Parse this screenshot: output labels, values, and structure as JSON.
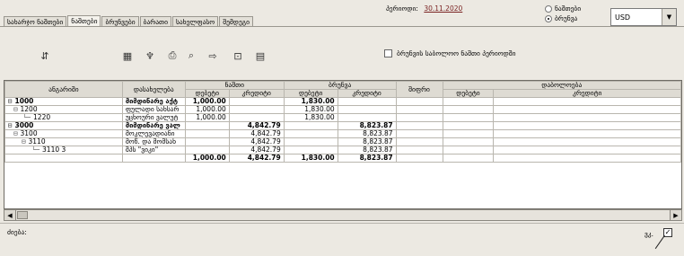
{
  "tabs": [
    {
      "label": "სახარჯო ნაშთები",
      "active": false
    },
    {
      "label": "ნაშთები",
      "active": true
    },
    {
      "label": "ბრუნვები",
      "active": false
    },
    {
      "label": "ბარათი",
      "active": false
    },
    {
      "label": "სახელფასო",
      "active": false
    },
    {
      "label": "შემდეგი",
      "active": false
    }
  ],
  "status": {
    "label": "პერიოდი:",
    "value": "30.11.2020"
  },
  "display_options": [
    {
      "label": "ნაშთები",
      "selected": false
    },
    {
      "label": "ბრუნვა",
      "selected": true
    }
  ],
  "currency": {
    "value": "USD"
  },
  "toolbar_icons": [
    "drill-icon",
    "calendar-icon",
    "filter-icon",
    "print-icon",
    "find-icon",
    "export-icon",
    "zoom-icon",
    "document-icon"
  ],
  "checkbox_label": "ბრუნვის საბოლოო ნაშთი პერიოდში",
  "grid": {
    "header": {
      "account": "ანგარიში",
      "description": "დასახელება",
      "opening": "ნაშთი",
      "turnover": "ბრუნვა",
      "code": "შიფრი",
      "closing": "დაბოლოება",
      "debit": "დებეტი",
      "credit": "კრედიტი"
    },
    "rows": [
      {
        "tree": "⊟",
        "account": "1000",
        "description": "მიმდინარე აქტ",
        "ob_debit": "1,000.00",
        "ob_credit": "",
        "tr_debit": "1,830.00",
        "tr_credit": "",
        "level": 0,
        "bold": true
      },
      {
        "tree": "⊟",
        "account": "1200",
        "description": "ფულადი სახსარ",
        "ob_debit": "1,000.00",
        "ob_credit": "",
        "tr_debit": "1,830.00",
        "tr_credit": "",
        "level": 1,
        "bold": false
      },
      {
        "tree": "└─",
        "account": "1220",
        "description": "უცხოური ვალუტ",
        "ob_debit": "1,000.00",
        "ob_credit": "",
        "tr_debit": "1,830.00",
        "tr_credit": "",
        "level": 2,
        "bold": false
      },
      {
        "tree": "⊟",
        "account": "3000",
        "description": "მიმდინარე ვალ",
        "ob_debit": "",
        "ob_credit": "4,842.79",
        "tr_debit": "",
        "tr_credit": "8,823.87",
        "level": 0,
        "bold": true
      },
      {
        "tree": "⊟",
        "account": "3100",
        "description": "მოკლევადიანი",
        "ob_debit": "",
        "ob_credit": "4,842.79",
        "tr_debit": "",
        "tr_credit": "8,823.87",
        "level": 1,
        "bold": false
      },
      {
        "tree": "⊟",
        "account": "3110",
        "description": "მოწ. და მომსახ",
        "ob_debit": "",
        "ob_credit": "4,842.79",
        "tr_debit": "",
        "tr_credit": "8,823.87",
        "level": 2,
        "bold": false
      },
      {
        "tree": "└─",
        "account": "3110 3",
        "description": "შპს \"ვიკი\"",
        "ob_debit": "",
        "ob_credit": "4,842.79",
        "tr_debit": "",
        "tr_credit": "8,823.87",
        "level": 3,
        "bold": false
      },
      {
        "tree": "",
        "account": "",
        "description": "",
        "ob_debit": "1,000.00",
        "ob_credit": "4,842.79",
        "tr_debit": "1,830.00",
        "tr_credit": "8,823.87",
        "level": 0,
        "bold": true
      }
    ]
  },
  "footer": {
    "left_label": "ძიება:",
    "right_label": "ვკ."
  }
}
